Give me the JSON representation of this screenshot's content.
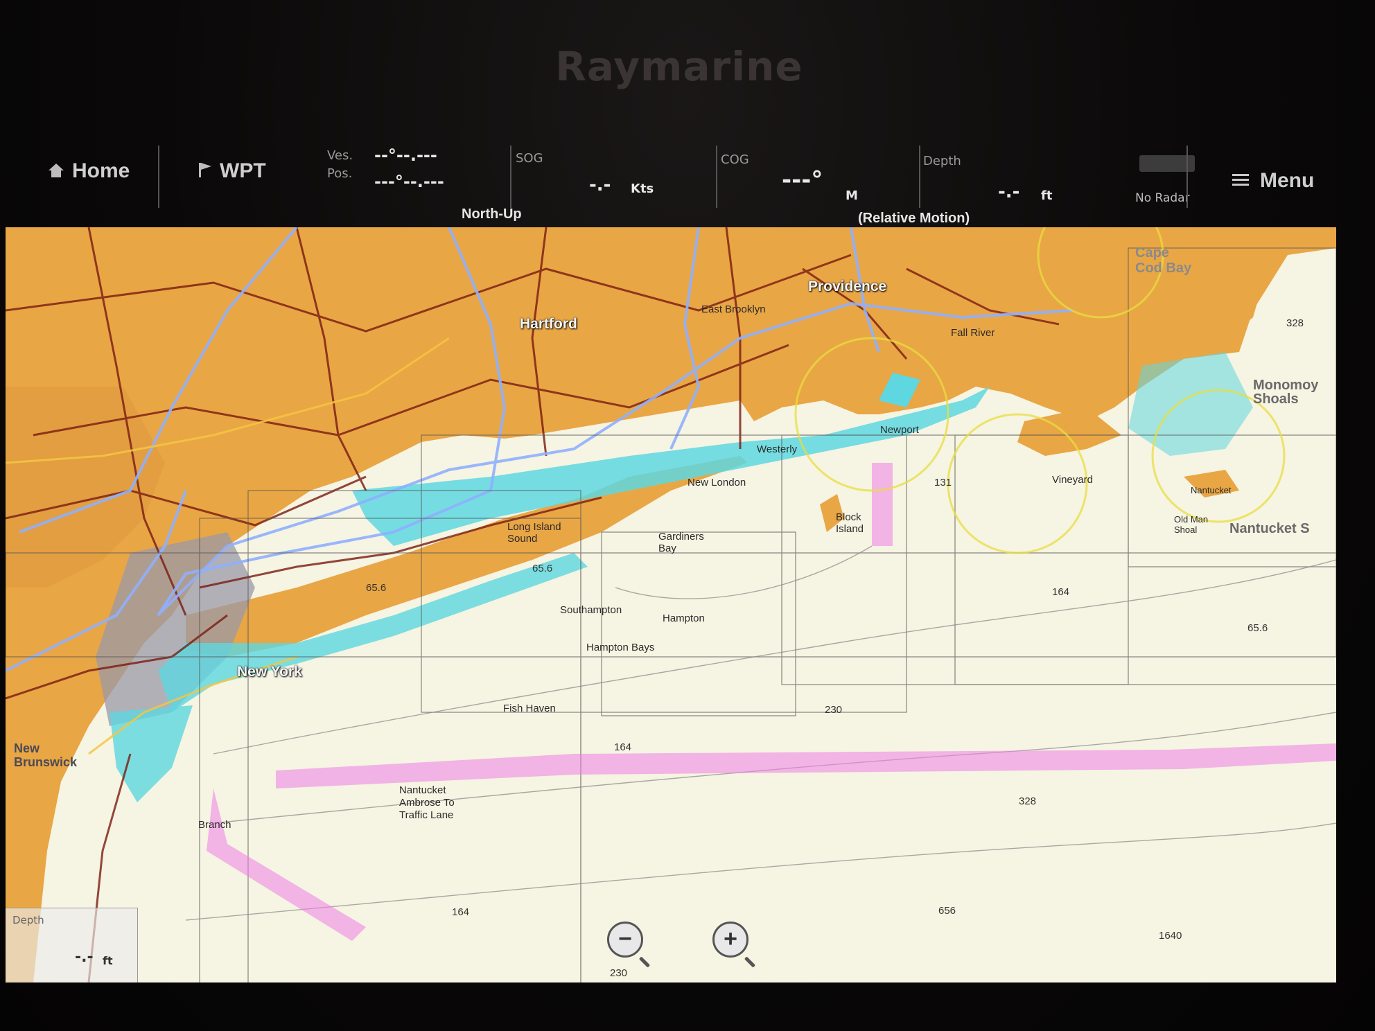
{
  "brand": "Raymarine",
  "toolbar": {
    "home_label": "Home",
    "wpt_label": "WPT",
    "ves_pos_label_1": "Ves.",
    "ves_pos_label_2": "Pos.",
    "ves_pos_line_1": "--°--.---",
    "ves_pos_line_2": "---°--.---",
    "sog_label": "SOG",
    "sog_value": "-.-",
    "sog_unit": "Kts",
    "cog_label": "COG",
    "cog_value": "---°",
    "cog_unit": "M",
    "depth_label": "Depth",
    "depth_value": "-.-",
    "depth_unit": "ft",
    "radar_label": "No Radar",
    "menu_label": "Menu",
    "orientation_mode": "North-Up",
    "motion_mode": "(Relative Motion)"
  },
  "chart": {
    "cities": {
      "hartford": "Hartford",
      "providence": "Providence",
      "new_york": "New York"
    },
    "regions": {
      "cape_cod_bay": "Cape Cod Bay",
      "monomoy_shoals": "Monomoy Shoals",
      "nantucket_s": "Nantucket S"
    },
    "places": {
      "east_brooklyn": "East Brooklyn",
      "fall_river": "Fall River",
      "new_london": "New London",
      "westerly": "Westerly",
      "newport": "Newport",
      "long_island_sound": "Long Island Sound",
      "gardiners_bay": "Gardiners Bay",
      "southampton": "Southampton",
      "hampton": "Hampton",
      "hampton_bays": "Hampton Bays",
      "fish_haven": "Fish Haven",
      "block_island": "Block Island",
      "vineyard": "Vineyard",
      "old_man_shoal": "Old Man Shoal",
      "nantucket": "Nantucket",
      "traffic_lane": "Nantucket Ambrose To Traffic Lane",
      "new_brunswick": "New Brunswick",
      "branch": "Branch"
    },
    "depths": {
      "d656a": "65.6",
      "d656b": "65.6",
      "d656c": "65.6",
      "d131": "131",
      "d164a": "164",
      "d164b": "164",
      "d164c": "164",
      "d230a": "230",
      "d230b": "230",
      "d328a": "328",
      "d328b": "328",
      "d656": "656",
      "d1640": "1640"
    },
    "depth_box": {
      "label": "Depth",
      "value": "-.-",
      "unit": "ft"
    },
    "zoom_out": "−",
    "zoom_in": "+"
  }
}
